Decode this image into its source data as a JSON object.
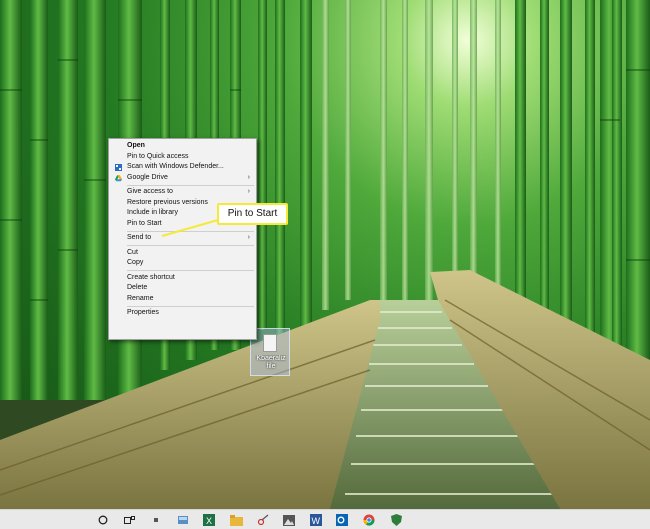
{
  "desktop": {
    "icon_label": "Kbaeraliz file"
  },
  "context_menu": {
    "items": [
      {
        "label": "Open",
        "bold": true
      },
      {
        "label": "Pin to Quick access"
      },
      {
        "label": "Scan with Windows Defender...",
        "icon": "defender-icon"
      },
      {
        "label": "Google Drive",
        "icon": "google-drive-icon",
        "submenu": true
      },
      {
        "label": "Give access to",
        "submenu": true
      },
      {
        "label": "Restore previous versions"
      },
      {
        "label": "Include in library",
        "submenu": true
      },
      {
        "label": "Pin to Start"
      },
      {
        "label": "Send to",
        "submenu": true
      },
      {
        "label": "Cut"
      },
      {
        "label": "Copy"
      },
      {
        "label": "Create shortcut"
      },
      {
        "label": "Delete"
      },
      {
        "label": "Rename"
      },
      {
        "label": "Properties"
      }
    ],
    "submenu_arrow": "›"
  },
  "callout": {
    "text": "Pin to Start",
    "border_color": "#f7e93a"
  },
  "taskbar": {
    "icons": [
      "cortana-search-icon",
      "task-view-icon",
      "tb-app-icon",
      "tb-app2-icon",
      "excel-icon",
      "file-explorer-icon",
      "snipping-tool-icon",
      "photos-icon",
      "word-icon",
      "outlook-icon",
      "chrome-icon",
      "security-icon"
    ]
  },
  "colors": {
    "callout_highlight": "#f7e93a",
    "menu_background": "#f2f2f2",
    "taskbar_background": "#e9e9e9"
  }
}
